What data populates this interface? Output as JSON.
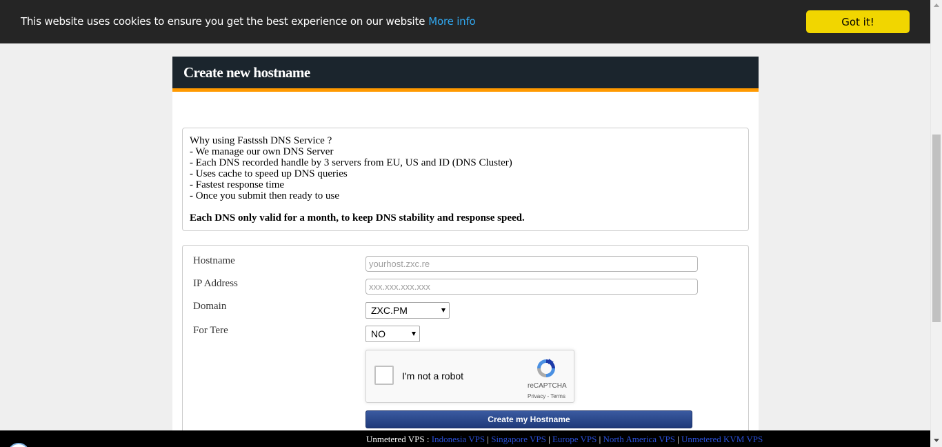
{
  "cookie": {
    "message": "This website uses cookies to ensure you get the best experience on our website",
    "more_info": "More info",
    "button": "Got it!"
  },
  "panel": {
    "title": "Create new hostname"
  },
  "info": {
    "lines": [
      "Why using Fastssh DNS Service ?",
      "- We manage our own DNS Server",
      "- Each DNS recorded handle by 3 servers from EU, US and ID (DNS Cluster)",
      "- Uses cache to speed up DNS queries",
      "- Fastest response time",
      "- Once you submit then ready to use"
    ],
    "note": "Each DNS only valid for a month, to keep DNS stability and response speed."
  },
  "form": {
    "hostname_label": "Hostname",
    "hostname_placeholder": "yourhost.zxc.re",
    "ip_label": "IP Address",
    "ip_placeholder": "xxx.xxx.xxx.xxx",
    "domain_label": "Domain",
    "domain_value": "ZXC.PM",
    "tere_label": "For Tere",
    "tere_value": "NO",
    "captcha_label": "I'm not a robot",
    "captcha_brand": "reCAPTCHA",
    "captcha_links": "Privacy - Terms",
    "submit": "Create my Hostname"
  },
  "footer": {
    "prefix": "Unmetered VPS :",
    "links": [
      "Indonesia VPS",
      "Singapore VPS",
      "Europe VPS",
      "North America VPS",
      "Unmetered KVM VPS"
    ],
    "separator": "|"
  },
  "colors": {
    "accent": "#ff9900",
    "header_bg": "#1b252d",
    "cookie_button": "#f1d600",
    "link": "#31a8f0"
  }
}
